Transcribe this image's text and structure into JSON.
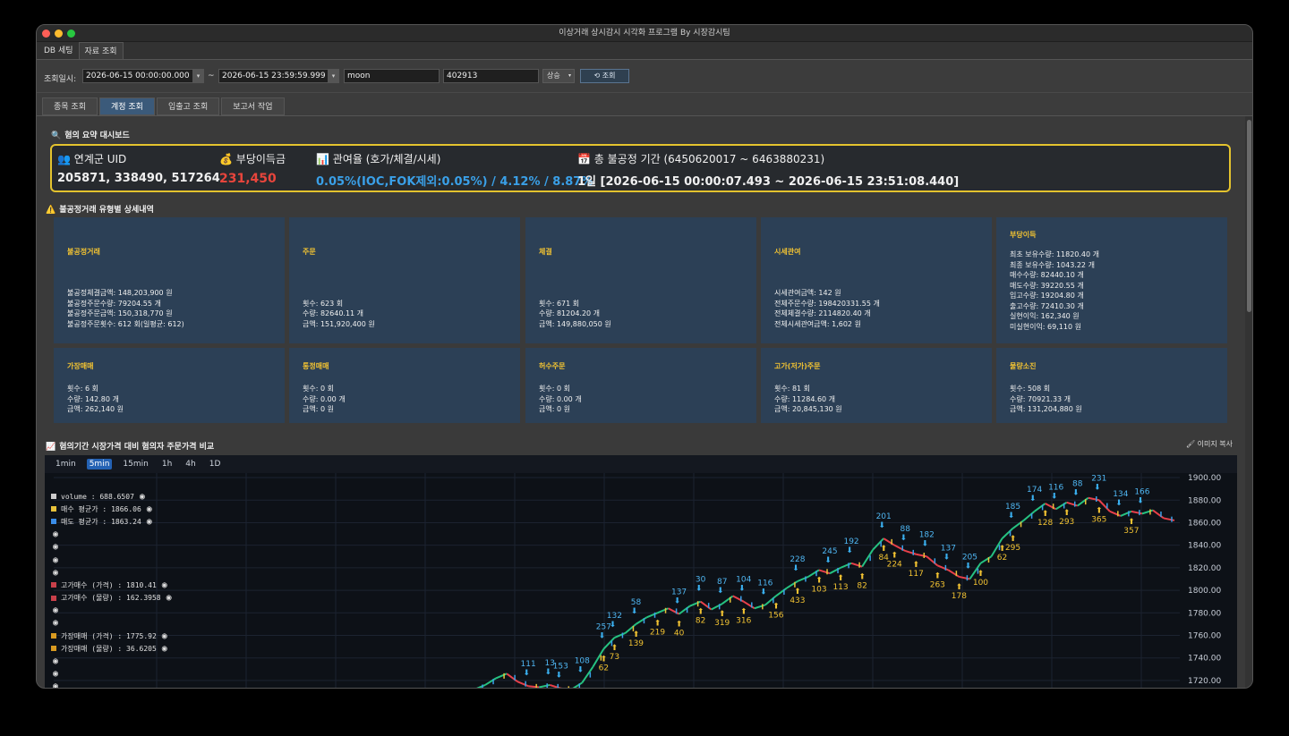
{
  "window": {
    "title": "이상거래 상시감시 시각화 프로그램 By 시장감시팀"
  },
  "top_tabs": [
    "DB 세팅",
    "자료 조회"
  ],
  "filter": {
    "label": "조회일시:",
    "start": "2026-06-15 00:00:00.000",
    "tilde": "~",
    "end": "2026-06-15 23:59:59.999",
    "text1": "moon",
    "text2": "402913",
    "select": "상승",
    "search_button": "조회"
  },
  "sub_tabs": [
    "종목 조회",
    "계정 조회",
    "입출고 조회",
    "보고서 작업"
  ],
  "dashboard": {
    "title": "혐의 요약 대시보드",
    "uid_label": "연계군 UID",
    "uid_value": "205871, 338490, 517264",
    "profit_label": "부당이득금",
    "profit_value": "231,450",
    "ratio_label": "관여율 (호가/체결/시세)",
    "ratio_value": "0.05%(IOC,FOK제외:0.05%) / 4.12% / 8.87%",
    "period_label": "총 불공정 기간 (6450620017 ~ 6463880231)",
    "period_value": "1일 [2026-06-15 00:00:07.493 ~ 2026-06-15 23:51:08.440]",
    "colors": {
      "profit": "#e8453c",
      "ratio": "#3aa0e8",
      "border": "#e4c32e"
    }
  },
  "detail": {
    "title": "불공정거래 유형별 상세내역",
    "cards": [
      {
        "title": "불공정거래",
        "lines": [
          "불공정체결금액: 148,203,900 원",
          "불공정주문수량: 79204.55 개",
          "불공정주문금액: 150,318,770 원",
          "불공정주문횟수: 612 회(일평균: 612)"
        ]
      },
      {
        "title": "주문",
        "lines": [
          "횟수: 623 회",
          "수량: 82640.11 개",
          "금액: 151,920,400 원"
        ]
      },
      {
        "title": "체결",
        "lines": [
          "횟수: 671 회",
          "수량: 81204.20 개",
          "금액: 149,880,050 원"
        ]
      },
      {
        "title": "시세관여",
        "lines": [
          "시세관여금액: 142 원",
          "전체주문수량: 198420331.55 개",
          "전체체결수량: 2114820.40 개",
          "전체시세관여금액: 1,602 원"
        ]
      },
      {
        "title": "부당이득",
        "lines": [
          "최초 보유수량: 11820.40 개",
          "최종 보유수량: 1043.22 개",
          "매수수량: 82440.10 개",
          "매도수량: 39220.55 개",
          "입고수량: 19204.80 개",
          "출고수량: 72410.30 개",
          "실현이익: 162,340 원",
          "미실현이익: 69,110 원"
        ]
      },
      {
        "title": "가장매매",
        "lines": [
          "횟수: 6 회",
          "수량: 142.80 개",
          "금액: 262,140 원"
        ]
      },
      {
        "title": "통정매매",
        "lines": [
          "횟수: 0 회",
          "수량: 0.00 개",
          "금액: 0 원"
        ]
      },
      {
        "title": "허수주문",
        "lines": [
          "횟수: 0 회",
          "수량: 0.00 개",
          "금액: 0 원"
        ]
      },
      {
        "title": "고가(저가)주문",
        "lines": [
          "횟수: 81 회",
          "수량: 11284.60 개",
          "금액: 20,845,130 원"
        ]
      },
      {
        "title": "물량소진",
        "lines": [
          "횟수: 508 회",
          "수량: 70921.33 개",
          "금액: 131,204,880 원"
        ]
      }
    ]
  },
  "chart_section": {
    "title": "혐의기간 시장가격 대비 혐의자 주문가격 비교",
    "copy_label": "이미지 복사",
    "timeframes": [
      "1min",
      "5min",
      "15min",
      "1h",
      "4h",
      "1D"
    ],
    "active_timeframe": "5min",
    "legend": [
      {
        "text": "volume : 688.6507",
        "color": "#cccccc"
      },
      {
        "text": "매수 평균가 : 1866.06",
        "color": "#e8c23a"
      },
      {
        "text": "매도 평균가 : 1863.24",
        "color": "#3a8de8"
      },
      {
        "text": "",
        "color": ""
      },
      {
        "text": "",
        "color": ""
      },
      {
        "text": "",
        "color": ""
      },
      {
        "text": "",
        "color": ""
      },
      {
        "text": "고가매수 (가격) : 1810.41",
        "color": "#c8404a"
      },
      {
        "text": "고가매수 (물량) : 162.3958",
        "color": "#c8404a"
      },
      {
        "text": "",
        "color": ""
      },
      {
        "text": "",
        "color": ""
      },
      {
        "text": "가장매매 (가격) : 1775.92",
        "color": "#d89a20"
      },
      {
        "text": "가장매매 (물량) : 36.6205",
        "color": "#d89a20"
      },
      {
        "text": "",
        "color": ""
      },
      {
        "text": "",
        "color": ""
      },
      {
        "text": "",
        "color": ""
      }
    ]
  },
  "chart_data": {
    "type": "line",
    "ylim": [
      1712,
      1904
    ],
    "yticks": [
      1720,
      1740,
      1760,
      1780,
      1800,
      1820,
      1840,
      1860,
      1880,
      1900
    ],
    "ytick_labels": [
      "1720.00",
      "1740.00",
      "1760.00",
      "1780.00",
      "1800.00",
      "1820.00",
      "1840.00",
      "1860.00",
      "1880.00",
      "1900.00"
    ],
    "price": [
      1712,
      1716,
      1722,
      1726,
      1719,
      1715,
      1714,
      1716,
      1713,
      1712,
      1718,
      1732,
      1748,
      1758,
      1762,
      1770,
      1776,
      1780,
      1784,
      1779,
      1786,
      1790,
      1783,
      1788,
      1795,
      1790,
      1784,
      1787,
      1795,
      1802,
      1808,
      1812,
      1818,
      1815,
      1820,
      1824,
      1821,
      1836,
      1846,
      1840,
      1835,
      1832,
      1830,
      1822,
      1818,
      1812,
      1810,
      1824,
      1830,
      1846,
      1855,
      1862,
      1870,
      1877,
      1872,
      1878,
      1875,
      1882,
      1880,
      1870,
      1866,
      1870,
      1868,
      1871,
      1864,
      1862
    ],
    "sell_labels": [
      {
        "i": 5,
        "text": "111"
      },
      {
        "i": 7,
        "text": "13"
      },
      {
        "i": 8,
        "text": "153"
      },
      {
        "i": 10,
        "text": "108"
      },
      {
        "i": 12,
        "text": "257"
      },
      {
        "i": 13,
        "text": "132"
      },
      {
        "i": 15,
        "text": "58"
      },
      {
        "i": 19,
        "text": "137"
      },
      {
        "i": 21,
        "text": "30"
      },
      {
        "i": 23,
        "text": "87"
      },
      {
        "i": 25,
        "text": "104"
      },
      {
        "i": 27,
        "text": "116"
      },
      {
        "i": 30,
        "text": "228"
      },
      {
        "i": 33,
        "text": "245"
      },
      {
        "i": 35,
        "text": "192"
      },
      {
        "i": 38,
        "text": "201"
      },
      {
        "i": 40,
        "text": "88"
      },
      {
        "i": 42,
        "text": "182"
      },
      {
        "i": 44,
        "text": "137"
      },
      {
        "i": 46,
        "text": "205"
      },
      {
        "i": 50,
        "text": "185"
      },
      {
        "i": 52,
        "text": "174"
      },
      {
        "i": 54,
        "text": "116"
      },
      {
        "i": 56,
        "text": "88"
      },
      {
        "i": 58,
        "text": "231"
      },
      {
        "i": 60,
        "text": "134"
      },
      {
        "i": 62,
        "text": "166"
      }
    ],
    "buy_labels": [
      {
        "i": 12,
        "text": "62"
      },
      {
        "i": 13,
        "text": "73"
      },
      {
        "i": 15,
        "text": "139"
      },
      {
        "i": 17,
        "text": "219"
      },
      {
        "i": 19,
        "text": "40"
      },
      {
        "i": 21,
        "text": "82"
      },
      {
        "i": 23,
        "text": "319"
      },
      {
        "i": 25,
        "text": "316"
      },
      {
        "i": 28,
        "text": "156"
      },
      {
        "i": 30,
        "text": "433"
      },
      {
        "i": 32,
        "text": "103"
      },
      {
        "i": 34,
        "text": "113"
      },
      {
        "i": 36,
        "text": "82"
      },
      {
        "i": 38,
        "text": "84"
      },
      {
        "i": 39,
        "text": "224"
      },
      {
        "i": 41,
        "text": "117"
      },
      {
        "i": 43,
        "text": "263"
      },
      {
        "i": 45,
        "text": "178"
      },
      {
        "i": 47,
        "text": "100"
      },
      {
        "i": 49,
        "text": "62"
      },
      {
        "i": 50,
        "text": "295"
      },
      {
        "i": 53,
        "text": "128"
      },
      {
        "i": 55,
        "text": "293"
      },
      {
        "i": 58,
        "text": "365"
      },
      {
        "i": 61,
        "text": "357"
      }
    ]
  }
}
